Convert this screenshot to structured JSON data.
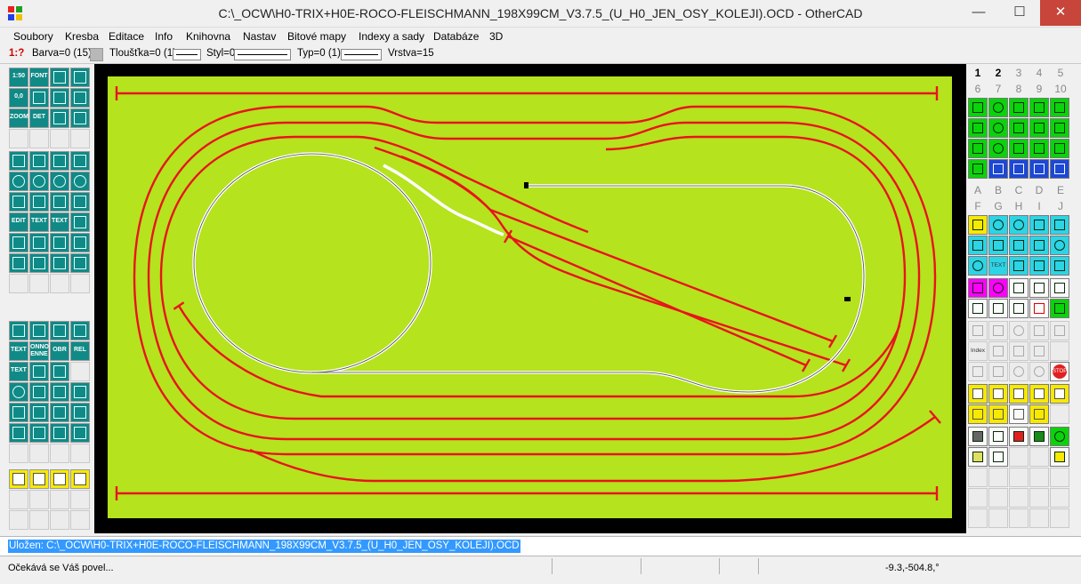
{
  "window": {
    "title": "C:\\_OCW\\H0-TRIX+H0E-ROCO-FLEISCHMANN_198X99CM_V3.7.5_(U_H0_JEN_OSY_KOLEJI).OCD - OtherCAD",
    "app_icon": "othercad-grid-icon",
    "minimize": "—",
    "maximize": "☐",
    "close": "✕"
  },
  "menu": [
    {
      "label": "Soubory"
    },
    {
      "label": "Kresba"
    },
    {
      "label": "Editace"
    },
    {
      "label": "Info"
    },
    {
      "label": "Knihovna"
    },
    {
      "label": "Nastav"
    },
    {
      "label": "Bitové mapy"
    },
    {
      "label": "Indexy a sady"
    },
    {
      "label": "Databáze"
    },
    {
      "label": "3D"
    }
  ],
  "properties": {
    "scale": "1:?",
    "color": "Barva=0 (15)",
    "thickness": "Tloušťka=0 (1)",
    "style": "Styl=0",
    "type": "Typ=0 (1)",
    "layer": "Vrstva=15"
  },
  "right_toolbar": {
    "tabs_row1": [
      "1",
      "2",
      "3",
      "4",
      "5"
    ],
    "tabs_row2": [
      "6",
      "7",
      "8",
      "9",
      "10"
    ],
    "letters_row1": [
      "A",
      "B",
      "C",
      "D",
      "E"
    ],
    "letters_row2": [
      "F",
      "G",
      "H",
      "I",
      "J"
    ],
    "text_tool": "TEXT",
    "index_tool": "Index",
    "stop_tool": "STOP"
  },
  "left_toolbar": {
    "scale_tool": "1:50",
    "font_tool": "FONT",
    "zero_tool": "0,0",
    "zoom_tool": "ZOOM",
    "det_tool": "DET",
    "edit_tool": "EDIT",
    "text_tool_a": "TEXT",
    "text_tool_b": "TEXT",
    "text_tool_c": "TEXT",
    "text_tool_d": "TEXT",
    "onno_tool": "ONNO",
    "enne_tool": "ENNE",
    "obr_tool": "OBR",
    "rel_tool": "REL"
  },
  "command_line": "Uložen: C:\\_OCW\\H0-TRIX+H0E-ROCO-FLEISCHMANN_198X99CM_V3.7.5_(U_H0_JEN_OSY_KOLEJI).OCD",
  "status": {
    "message": "Očekává se Váš povel...",
    "coords": "-9.3,-504.8,°"
  },
  "colors": {
    "canvas": "#b5e31d",
    "track_red": "#e8141c",
    "track_white": "#ffffff",
    "frame": "#000000"
  }
}
